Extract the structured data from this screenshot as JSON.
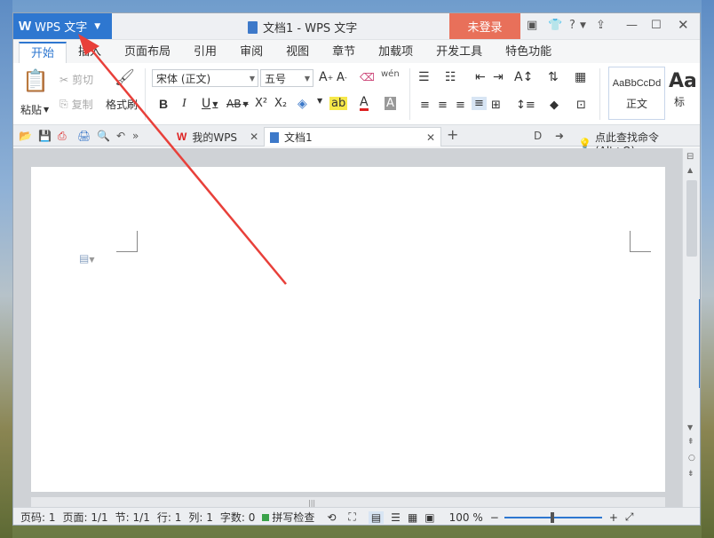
{
  "titlebar": {
    "app_name": "WPS 文字",
    "app_logo": "W",
    "doc_title": "文档1 - WPS 文字",
    "login": "未登录",
    "help": "?"
  },
  "menu_tabs": [
    "开始",
    "插入",
    "页面布局",
    "引用",
    "审阅",
    "视图",
    "章节",
    "加载项",
    "开发工具",
    "特色功能"
  ],
  "ribbon": {
    "paste": "粘贴",
    "cut": "剪切",
    "copy": "复制",
    "format_painter": "格式刷",
    "font_name": "宋体 (正文)",
    "font_size": "五号",
    "bold": "B",
    "italic": "I",
    "underline": "U",
    "strike": "AB",
    "superscript": "X²",
    "subscript": "X₂",
    "style_preview_1": "AaBbCcDd",
    "style_label_1": "正文",
    "style_preview_2": "Aa",
    "style_label_2": "标"
  },
  "tabbar": {
    "tab_mywps": "我的WPS",
    "tab_doc": "文档1",
    "command_search": "点此查找命令 (Alt+Q)"
  },
  "statusbar": {
    "page_no": "页码: 1",
    "pages": "页面: 1/1",
    "section": "节: 1/1",
    "row": "行: 1",
    "col": "列: 1",
    "word_count": "字数: 0",
    "spell_check": "拼写检查",
    "zoom": "100 %"
  },
  "icons": {
    "app_logo": "wps-logo-icon",
    "arrow_annotation": "red-arrow"
  },
  "colors": {
    "accent": "#2e77d0",
    "login": "#e8705a",
    "annotation": "#e8403a"
  }
}
